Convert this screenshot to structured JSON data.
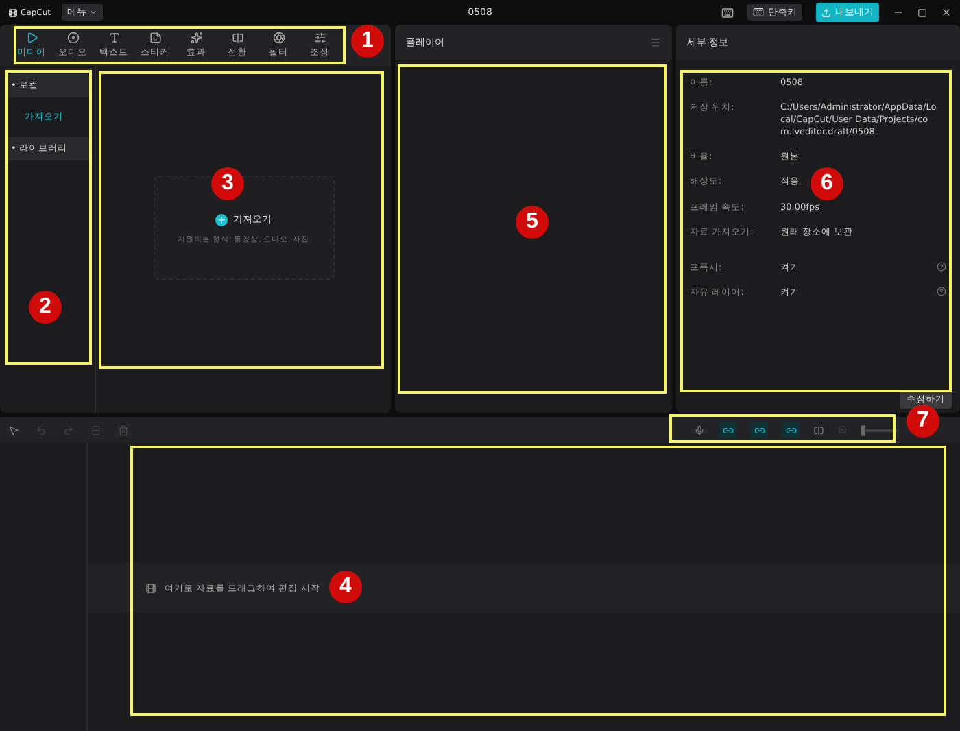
{
  "app": {
    "logo": "CapCut",
    "menu": "메뉴",
    "title": "0508",
    "shortcut": "단축키",
    "export": "내보내기"
  },
  "media_tabs": [
    {
      "label": "미디어",
      "selected": true
    },
    {
      "label": "오디오",
      "selected": false
    },
    {
      "label": "텍스트",
      "selected": false
    },
    {
      "label": "스티커",
      "selected": false
    },
    {
      "label": "효과",
      "selected": false
    },
    {
      "label": "전환",
      "selected": false
    },
    {
      "label": "필터",
      "selected": false
    },
    {
      "label": "조정",
      "selected": false
    }
  ],
  "sidebar": {
    "items": [
      {
        "label": "• 로컬",
        "kind": "group",
        "selected": false
      },
      {
        "label": "가져오기",
        "kind": "item",
        "selected": true
      },
      {
        "label": "• 라이브러리",
        "kind": "group",
        "selected": false
      }
    ]
  },
  "import_card": {
    "button": "가져오기",
    "hint": "지원되는 형식: 동영상, 오디오, 사진"
  },
  "player": {
    "title": "플레이어"
  },
  "details": {
    "title": "세부 정보",
    "rows": [
      {
        "label": "이름:",
        "value": "0508",
        "help": false
      },
      {
        "label": "저장 위치:",
        "value": "C:/Users/Administrator/AppData/Local/CapCut/User Data/Projects/com.lveditor.draft/0508",
        "help": false
      },
      {
        "label": "비율:",
        "value": "원본",
        "help": false
      },
      {
        "label": "해상도:",
        "value": "적응",
        "help": false
      },
      {
        "label": "프레임 속도:",
        "value": "30.00fps",
        "help": false
      },
      {
        "label": "자료 가져오기:",
        "value": "원래 장소에 보관",
        "help": false
      },
      {
        "label": "프록시:",
        "value": "켜기",
        "help": true
      },
      {
        "label": "자유 레이어:",
        "value": "켜기",
        "help": true
      }
    ],
    "button": "수정하기"
  },
  "timeline": {
    "hint": "여기로 자료를 드래그하여 편집 시작",
    "zoom": {
      "level": 0.1
    }
  },
  "annotations": [
    {
      "number": "1"
    },
    {
      "number": "2"
    },
    {
      "number": "3"
    },
    {
      "number": "4"
    },
    {
      "number": "5"
    },
    {
      "number": "6"
    },
    {
      "number": "7"
    }
  ]
}
